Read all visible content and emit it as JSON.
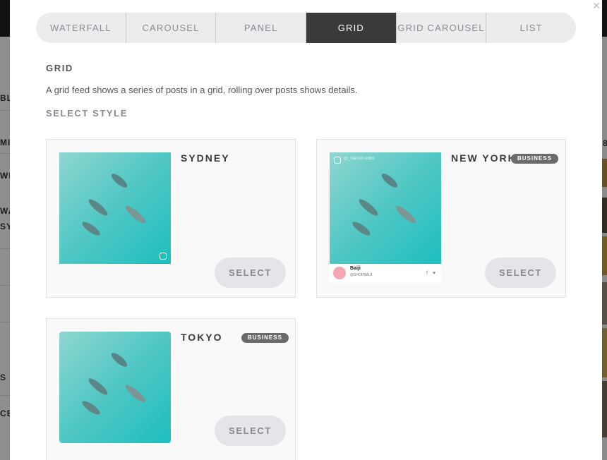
{
  "tabs": [
    "WATERFALL",
    "CAROUSEL",
    "PANEL",
    "GRID",
    "GRID CAROUSEL",
    "LIST"
  ],
  "active_tab": "GRID",
  "section": {
    "title": "GRID",
    "description": "A grid feed shows a series of posts in a grid, rolling over posts shows details.",
    "subtitle": "SELECT STYLE"
  },
  "styles": [
    {
      "name": "SYDNEY",
      "badge": "",
      "button": "SELECT"
    },
    {
      "name": "NEW YORK",
      "badge": "BUSINESS",
      "button": "SELECT",
      "preview": {
        "account_name": "Baiji",
        "account_handle": "@SHOPBAIJI",
        "handle_overlay": "@_hamish.ebbs"
      }
    },
    {
      "name": "TOKYO",
      "badge": "BUSINESS",
      "button": "SELECT"
    }
  ],
  "background_page": {
    "left_fragments": [
      "BLI",
      "MI",
      "WE",
      "WA",
      "SY",
      "S",
      "CE"
    ],
    "right_fragments": [
      "8"
    ]
  },
  "colors": {
    "active_tab_bg": "#3a3a3b",
    "tab_bg": "#ebecee",
    "badge_bg": "#6b6b6b",
    "select_bg": "#e3e5e8",
    "water": "#3cc6c6"
  },
  "icons": {
    "close": "close-icon",
    "instagram": "instagram-icon",
    "facebook": "facebook-icon",
    "twitter": "twitter-icon"
  }
}
